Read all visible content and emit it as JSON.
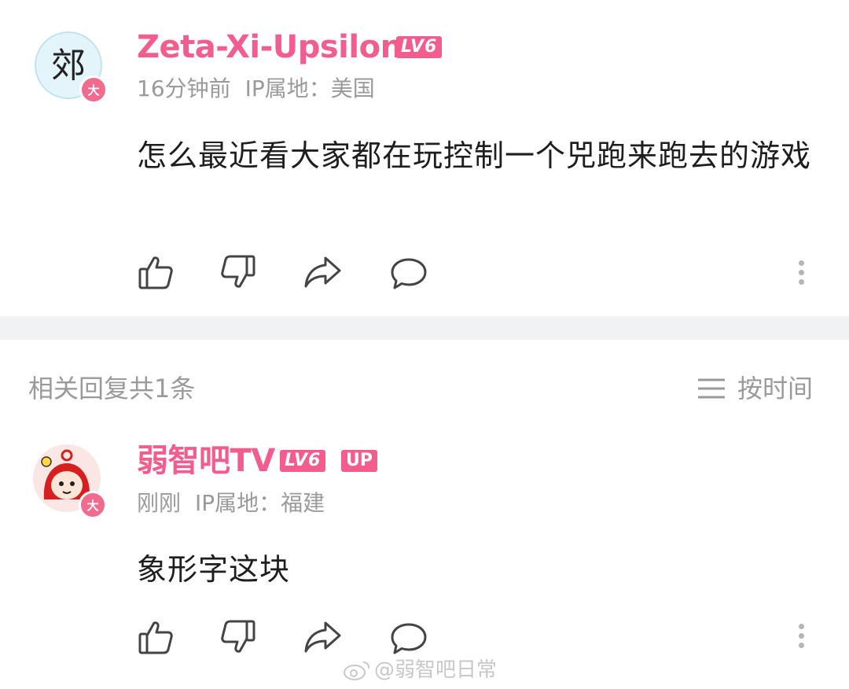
{
  "comment": {
    "username": "Zeta-Xi-Upsilon",
    "level_badge": "LV6",
    "avatar_glyph": "郊",
    "vip_badge": "大",
    "time": "16分钟前",
    "ip": "IP属地：美国",
    "text": "怎么最近看大家都在玩控制一个兕跑来跑去的游戏"
  },
  "replies_section": {
    "title": "相关回复共1条",
    "sort_label": "按时间"
  },
  "reply": {
    "username": "弱智吧TV",
    "level_badge": "LV6",
    "up_badge": "UP",
    "vip_badge": "大",
    "time": "刚刚",
    "ip": "IP属地：福建",
    "text": "象形字这块"
  },
  "watermark": "@弱智吧日常",
  "icons": [
    "thumbs-up-icon",
    "thumbs-down-icon",
    "share-icon",
    "comment-icon",
    "more-icon",
    "list-icon",
    "weibo-icon"
  ],
  "colors": {
    "accent": "#f25d8e",
    "meta_gray": "#9a9a9a",
    "band": "#f1f2f3"
  }
}
